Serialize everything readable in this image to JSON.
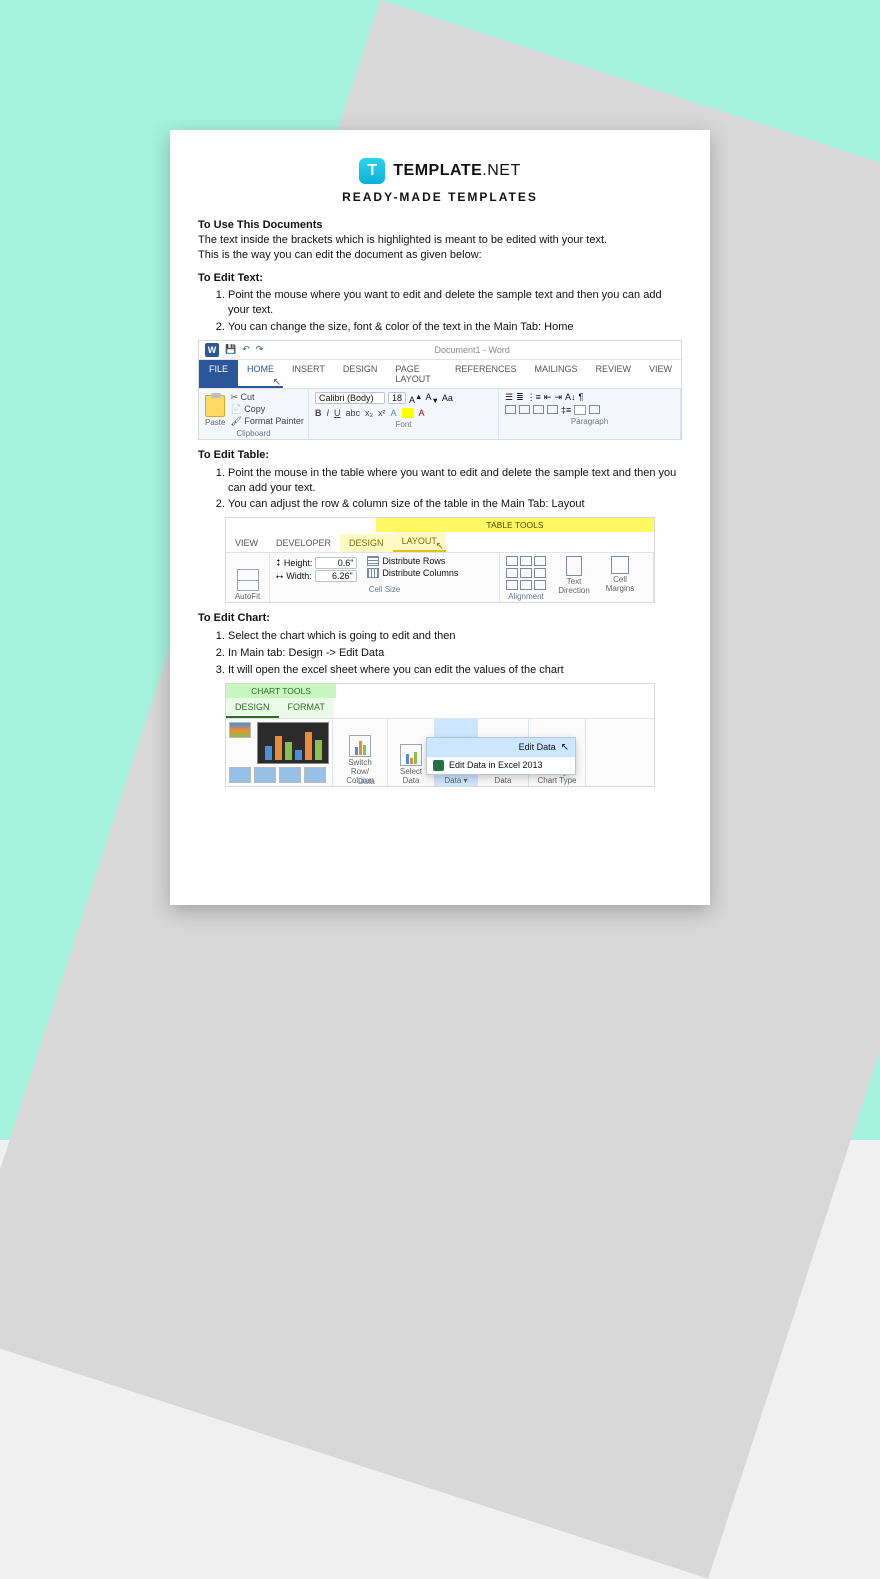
{
  "brand": {
    "badge": "T",
    "name": "TEMPLATE",
    "net": ".NET"
  },
  "subtitle": "READY-MADE TEMPLATES",
  "intro": {
    "heading": "To Use This Documents",
    "line1": "The text inside the brackets which is highlighted is meant to be edited with your text.",
    "line2": "This is the way you can edit the document as given below:"
  },
  "sec_text": {
    "heading": "To Edit Text:",
    "items": [
      "Point the mouse where you want to edit and delete the sample text and then you can add your text.",
      "You can change the size, font & color of the text in the Main Tab: Home"
    ]
  },
  "sec_table": {
    "heading": "To Edit Table:",
    "items": [
      "Point the mouse in the table where you want to edit and delete the sample text and then you can add your text.",
      "You can adjust the row & column size of the table in the Main Tab: Layout"
    ]
  },
  "sec_chart": {
    "heading": "To Edit Chart:",
    "items": [
      "Select the chart which is going to edit and then",
      "In Main tab: Design -> Edit Data",
      "It will open the excel sheet where you can edit the values of the chart"
    ]
  },
  "word": {
    "doc_title": "Document1 - Word",
    "file": "FILE",
    "tabs": [
      "HOME",
      "INSERT",
      "DESIGN",
      "PAGE LAYOUT",
      "REFERENCES",
      "MAILINGS",
      "REVIEW",
      "VIEW"
    ],
    "paste": "Paste",
    "cut": "Cut",
    "copy": "Copy",
    "painter": "Format Painter",
    "grp_clipboard": "Clipboard",
    "grp_font": "Font",
    "grp_para": "Paragraph",
    "font_name": "Calibri (Body)",
    "font_size": "18"
  },
  "table_tools": {
    "band": "TABLE TOOLS",
    "tabs_left": [
      "VIEW",
      "DEVELOPER"
    ],
    "tabs_yellow": [
      "DESIGN",
      "LAYOUT"
    ],
    "autofit": "AutoFit",
    "height_lab": "Height:",
    "height_val": "0.6\"",
    "width_lab": "Width:",
    "width_val": "6.26\"",
    "dist_rows": "Distribute Rows",
    "dist_cols": "Distribute Columns",
    "grp_cell": "Cell Size",
    "grp_align": "Alignment",
    "text_dir": "Text Direction",
    "cell_marg": "Cell Margins"
  },
  "chart_tools": {
    "band": "CHART TOOLS",
    "tabs": [
      "DESIGN",
      "FORMAT"
    ],
    "switch": "Switch Row/ Column",
    "select": "Select Data",
    "edit": "Edit Data",
    "refresh": "Refresh Data",
    "change": "Change Chart Type",
    "grp_data": "Data",
    "menu1": "Edit Data",
    "menu2": "Edit Data in Excel 2013"
  }
}
